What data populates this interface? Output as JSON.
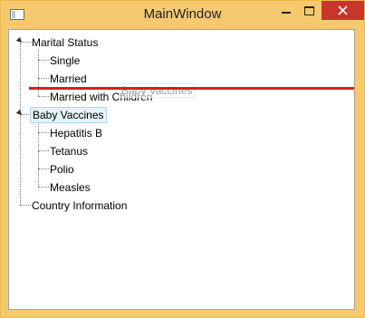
{
  "window": {
    "title": "MainWindow",
    "controls": {
      "minimize": "minimize",
      "maximize": "maximize",
      "close": "close"
    },
    "accent_close": "#c7362b",
    "frame_color": "#f5ca6f"
  },
  "tree": {
    "nodes": [
      {
        "label": "Marital Status",
        "expanded": true,
        "children": [
          "Single",
          "Married",
          "Married with Children"
        ]
      },
      {
        "label": "Baby Vaccines",
        "expanded": true,
        "selected": true,
        "children": [
          "Hepatitis B",
          "Tetanus",
          "Polio",
          "Measles"
        ]
      },
      {
        "label": "Country Information",
        "expanded": false,
        "children": []
      }
    ]
  },
  "drag": {
    "ghost_label": "Baby Vaccines",
    "indicator_color": "#d2201f"
  }
}
